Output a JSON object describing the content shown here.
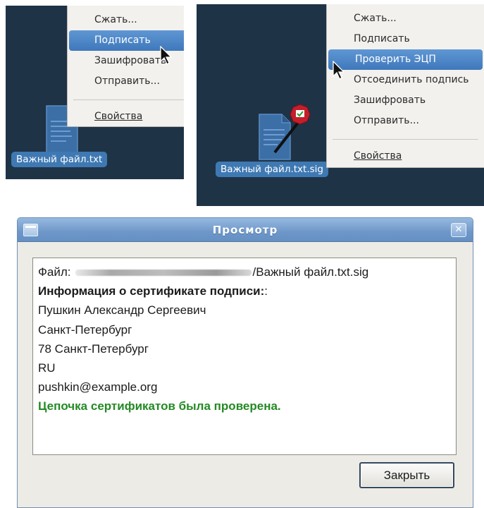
{
  "left_panel": {
    "file_label": "Важный файл.txt",
    "icon": "text-file-icon",
    "menu": {
      "items": [
        "Сжать...",
        "Подписать",
        "Зашифровать",
        "Отправить..."
      ],
      "highlighted": "Подписать",
      "properties": "Свойства"
    }
  },
  "right_panel": {
    "file_label": "Важный файл.txt.sig",
    "icon": "signed-file-icon",
    "menu": {
      "items": [
        "Сжать...",
        "Подписать",
        "Проверить ЭЦП",
        "Отсоединить подпись",
        "Зашифровать",
        "Отправить..."
      ],
      "highlighted": "Проверить ЭЦП",
      "properties": "Свойства"
    }
  },
  "dialog": {
    "title": "Просмотр",
    "file_prefix": "Файл:",
    "file_suffix": "/Важный файл.txt.sig",
    "cert_heading": "Информация о сертификате подписи:",
    "cert_heading_tail": ":",
    "lines": [
      "Пушкин Александр Сергеевич",
      "Санкт-Петербург",
      "78 Санкт-Петербург",
      "RU",
      "pushkin@example.org"
    ],
    "status": "Цепочка сертификатов была проверена.",
    "close_button": "Закрыть"
  },
  "colors": {
    "desktop": "#1f3346",
    "highlight": "#4a84c4",
    "status_green": "#248a24",
    "titlebar": "#7aa2d0"
  }
}
